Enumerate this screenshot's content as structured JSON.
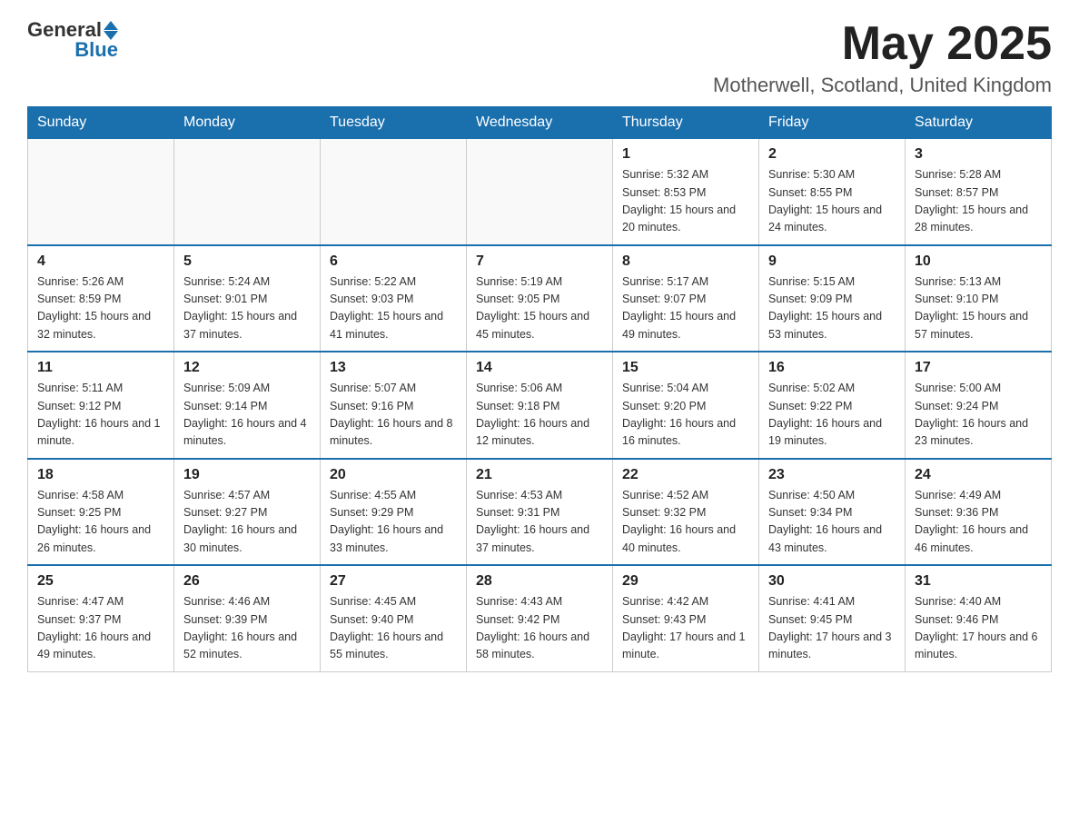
{
  "header": {
    "logo_general": "General",
    "logo_blue": "Blue",
    "month_year": "May 2025",
    "location": "Motherwell, Scotland, United Kingdom"
  },
  "days_of_week": [
    "Sunday",
    "Monday",
    "Tuesday",
    "Wednesday",
    "Thursday",
    "Friday",
    "Saturday"
  ],
  "weeks": [
    {
      "days": [
        {
          "num": "",
          "info": ""
        },
        {
          "num": "",
          "info": ""
        },
        {
          "num": "",
          "info": ""
        },
        {
          "num": "",
          "info": ""
        },
        {
          "num": "1",
          "info": "Sunrise: 5:32 AM\nSunset: 8:53 PM\nDaylight: 15 hours and 20 minutes."
        },
        {
          "num": "2",
          "info": "Sunrise: 5:30 AM\nSunset: 8:55 PM\nDaylight: 15 hours and 24 minutes."
        },
        {
          "num": "3",
          "info": "Sunrise: 5:28 AM\nSunset: 8:57 PM\nDaylight: 15 hours and 28 minutes."
        }
      ]
    },
    {
      "days": [
        {
          "num": "4",
          "info": "Sunrise: 5:26 AM\nSunset: 8:59 PM\nDaylight: 15 hours and 32 minutes."
        },
        {
          "num": "5",
          "info": "Sunrise: 5:24 AM\nSunset: 9:01 PM\nDaylight: 15 hours and 37 minutes."
        },
        {
          "num": "6",
          "info": "Sunrise: 5:22 AM\nSunset: 9:03 PM\nDaylight: 15 hours and 41 minutes."
        },
        {
          "num": "7",
          "info": "Sunrise: 5:19 AM\nSunset: 9:05 PM\nDaylight: 15 hours and 45 minutes."
        },
        {
          "num": "8",
          "info": "Sunrise: 5:17 AM\nSunset: 9:07 PM\nDaylight: 15 hours and 49 minutes."
        },
        {
          "num": "9",
          "info": "Sunrise: 5:15 AM\nSunset: 9:09 PM\nDaylight: 15 hours and 53 minutes."
        },
        {
          "num": "10",
          "info": "Sunrise: 5:13 AM\nSunset: 9:10 PM\nDaylight: 15 hours and 57 minutes."
        }
      ]
    },
    {
      "days": [
        {
          "num": "11",
          "info": "Sunrise: 5:11 AM\nSunset: 9:12 PM\nDaylight: 16 hours and 1 minute."
        },
        {
          "num": "12",
          "info": "Sunrise: 5:09 AM\nSunset: 9:14 PM\nDaylight: 16 hours and 4 minutes."
        },
        {
          "num": "13",
          "info": "Sunrise: 5:07 AM\nSunset: 9:16 PM\nDaylight: 16 hours and 8 minutes."
        },
        {
          "num": "14",
          "info": "Sunrise: 5:06 AM\nSunset: 9:18 PM\nDaylight: 16 hours and 12 minutes."
        },
        {
          "num": "15",
          "info": "Sunrise: 5:04 AM\nSunset: 9:20 PM\nDaylight: 16 hours and 16 minutes."
        },
        {
          "num": "16",
          "info": "Sunrise: 5:02 AM\nSunset: 9:22 PM\nDaylight: 16 hours and 19 minutes."
        },
        {
          "num": "17",
          "info": "Sunrise: 5:00 AM\nSunset: 9:24 PM\nDaylight: 16 hours and 23 minutes."
        }
      ]
    },
    {
      "days": [
        {
          "num": "18",
          "info": "Sunrise: 4:58 AM\nSunset: 9:25 PM\nDaylight: 16 hours and 26 minutes."
        },
        {
          "num": "19",
          "info": "Sunrise: 4:57 AM\nSunset: 9:27 PM\nDaylight: 16 hours and 30 minutes."
        },
        {
          "num": "20",
          "info": "Sunrise: 4:55 AM\nSunset: 9:29 PM\nDaylight: 16 hours and 33 minutes."
        },
        {
          "num": "21",
          "info": "Sunrise: 4:53 AM\nSunset: 9:31 PM\nDaylight: 16 hours and 37 minutes."
        },
        {
          "num": "22",
          "info": "Sunrise: 4:52 AM\nSunset: 9:32 PM\nDaylight: 16 hours and 40 minutes."
        },
        {
          "num": "23",
          "info": "Sunrise: 4:50 AM\nSunset: 9:34 PM\nDaylight: 16 hours and 43 minutes."
        },
        {
          "num": "24",
          "info": "Sunrise: 4:49 AM\nSunset: 9:36 PM\nDaylight: 16 hours and 46 minutes."
        }
      ]
    },
    {
      "days": [
        {
          "num": "25",
          "info": "Sunrise: 4:47 AM\nSunset: 9:37 PM\nDaylight: 16 hours and 49 minutes."
        },
        {
          "num": "26",
          "info": "Sunrise: 4:46 AM\nSunset: 9:39 PM\nDaylight: 16 hours and 52 minutes."
        },
        {
          "num": "27",
          "info": "Sunrise: 4:45 AM\nSunset: 9:40 PM\nDaylight: 16 hours and 55 minutes."
        },
        {
          "num": "28",
          "info": "Sunrise: 4:43 AM\nSunset: 9:42 PM\nDaylight: 16 hours and 58 minutes."
        },
        {
          "num": "29",
          "info": "Sunrise: 4:42 AM\nSunset: 9:43 PM\nDaylight: 17 hours and 1 minute."
        },
        {
          "num": "30",
          "info": "Sunrise: 4:41 AM\nSunset: 9:45 PM\nDaylight: 17 hours and 3 minutes."
        },
        {
          "num": "31",
          "info": "Sunrise: 4:40 AM\nSunset: 9:46 PM\nDaylight: 17 hours and 6 minutes."
        }
      ]
    }
  ]
}
